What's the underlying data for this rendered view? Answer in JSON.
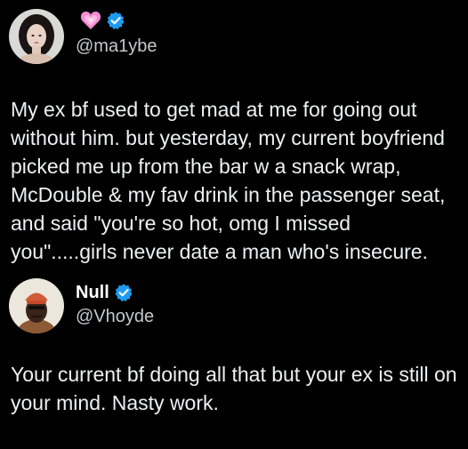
{
  "tweets": [
    {
      "display_name": "",
      "name_badge_icon": "pink-heart-icon",
      "verified_icon": "verified-badge-icon",
      "handle": "@ma1ybe",
      "text": "My ex bf used to get mad at me for going out without him. but yesterday, my current boyfriend picked me up from the bar w a snack wrap, McDouble & my fav drink in the passenger seat, and said \"you're so hot, omg I missed you\".....girls never date a man who's insecure."
    },
    {
      "display_name": "Null",
      "verified_icon": "verified-badge-icon",
      "handle": "@Vhoyde",
      "text": "Your current bf doing all that but your ex is still on your mind. Nasty work."
    }
  ],
  "colors": {
    "background": "#000000",
    "text": "#e7e9ea",
    "handle": "#c4c8cc",
    "verified": "#1d9bf0",
    "heart": "#f58bd0"
  }
}
